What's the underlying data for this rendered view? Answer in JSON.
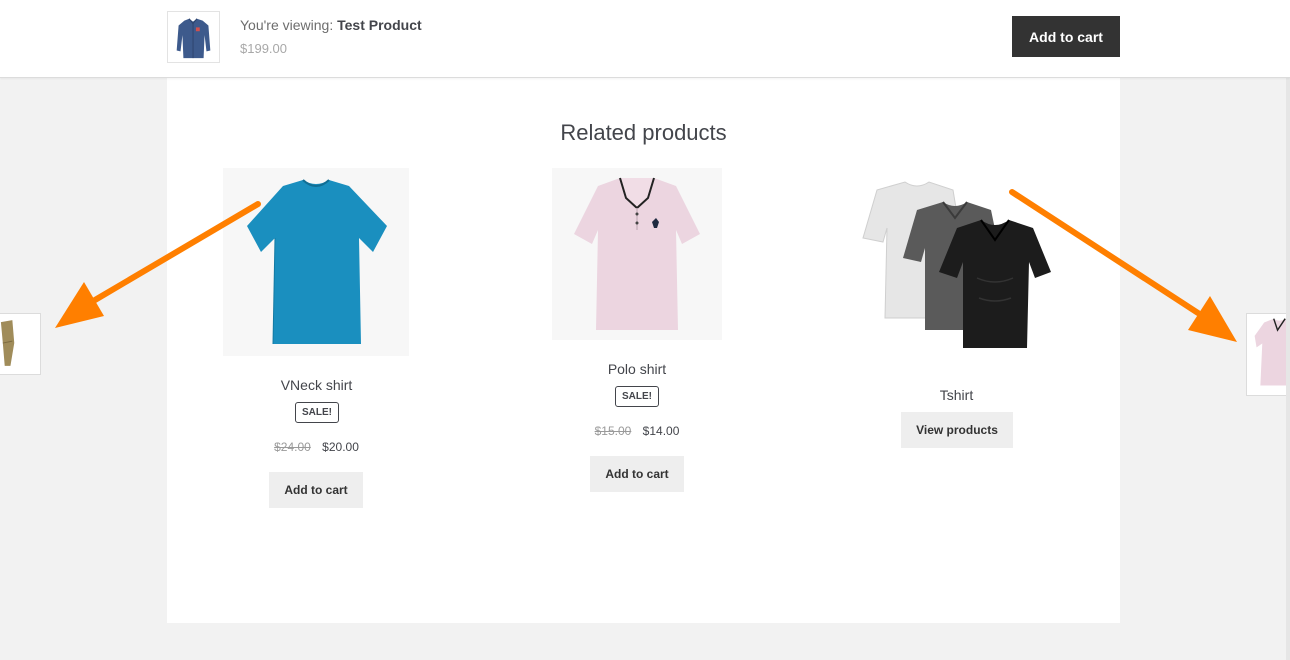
{
  "sticky": {
    "viewing_prefix": "You're viewing:",
    "product_name": "Test Product",
    "price": "$199.00",
    "add_to_cart": "Add to cart"
  },
  "related": {
    "title": "Related products",
    "products": [
      {
        "name": "VNeck shirt",
        "badge": "SALE!",
        "old_price": "$24.00",
        "price": "$20.00",
        "button": "Add to cart",
        "image": "blue-tshirt"
      },
      {
        "name": "Polo shirt",
        "badge": "SALE!",
        "old_price": "$15.00",
        "price": "$14.00",
        "button": "Add to cart",
        "image": "pink-polo"
      },
      {
        "name": "Tshirt",
        "button": "View products",
        "image": "three-tshirts"
      }
    ]
  },
  "colors": {
    "accent_arrow": "#ff7f00",
    "dark_button": "#333333",
    "light_button": "#eeeeee"
  }
}
